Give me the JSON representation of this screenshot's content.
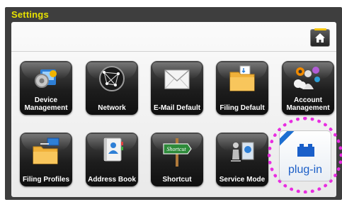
{
  "header": {
    "title": "Settings"
  },
  "tiles": [
    {
      "label_line1": "Device",
      "label_line2": "Management",
      "icon": "device-management-icon"
    },
    {
      "label": "Network",
      "icon": "network-globe-icon"
    },
    {
      "label": "E-Mail Default",
      "icon": "envelope-icon"
    },
    {
      "label": "Filing Default",
      "icon": "folder-icon"
    },
    {
      "label_line1": "Account",
      "label_line2": "Management",
      "icon": "account-gears-icon"
    },
    {
      "label": "Filing Profiles",
      "icon": "filing-profiles-icon"
    },
    {
      "label": "Address Book",
      "icon": "address-book-icon"
    },
    {
      "label": "Shortcut",
      "icon": "signpost-icon",
      "sign_text": "Shortcut"
    },
    {
      "label": "Service Mode",
      "icon": "service-mode-icon"
    }
  ],
  "plugin": {
    "label": "plug-in",
    "icon": "plugin-block-icon"
  },
  "colors": {
    "title": "#e8e200",
    "frame": "#3e3e3e",
    "highlight_ring": "#e82de0",
    "plugin_text": "#1b5ec7"
  }
}
